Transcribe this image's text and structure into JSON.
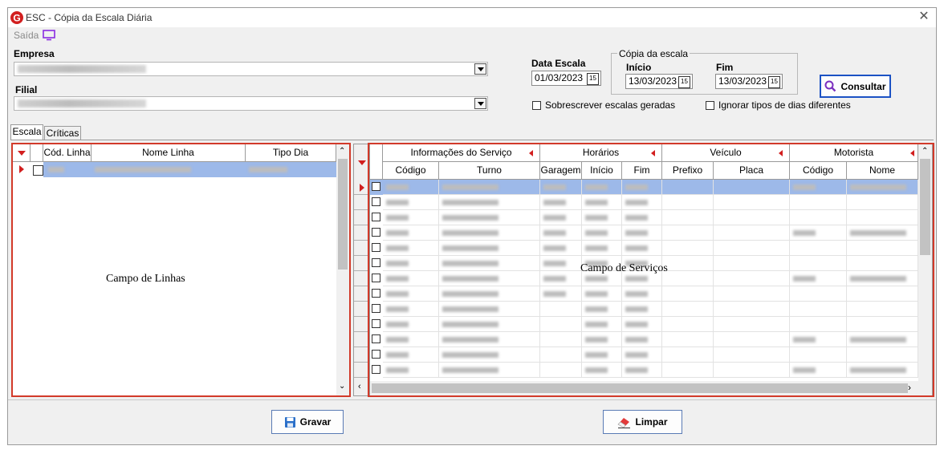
{
  "window": {
    "title": "ESC - Cópia da Escala Diária",
    "close_glyph": "✕"
  },
  "menu": {
    "exit_label": "Saída"
  },
  "form": {
    "empresa_label": "Empresa",
    "filial_label": "Filial",
    "data_escala_label": "Data Escala",
    "data_escala_value": "01/03/2023",
    "copia_group_label": "Cópia da escala",
    "inicio_label": "Início",
    "inicio_value": "13/03/2023",
    "fim_label": "Fim",
    "fim_value": "13/03/2023",
    "consultar_label": "Consultar",
    "sobrescrever_label": "Sobrescrever escalas geradas",
    "ignorar_label": "Ignorar tipos de dias diferentes",
    "calendar_glyph": "15"
  },
  "tabs": [
    {
      "label": "Escala"
    },
    {
      "label": "Críticas"
    }
  ],
  "lines_grid": {
    "headers": [
      "Cód. Linha",
      "Nome Linha",
      "Tipo Dia"
    ],
    "overlay_label": "Campo de Linhas"
  },
  "services_grid": {
    "group_headers": [
      "Informações do Serviço",
      "Horários",
      "Veículo",
      "Motorista"
    ],
    "headers": [
      "Código",
      "Turno",
      "Garagem",
      "Início",
      "Fim",
      "Prefixo",
      "Placa",
      "Código",
      "Nome"
    ],
    "overlay_label": "Campo de Serviços",
    "row_count": 13
  },
  "buttons": {
    "gravar_label": "Gravar",
    "limpar_label": "Limpar"
  },
  "colors": {
    "accent_red": "#d23a2a",
    "selection": "#9db9e9",
    "brand": "#d21f1f"
  }
}
